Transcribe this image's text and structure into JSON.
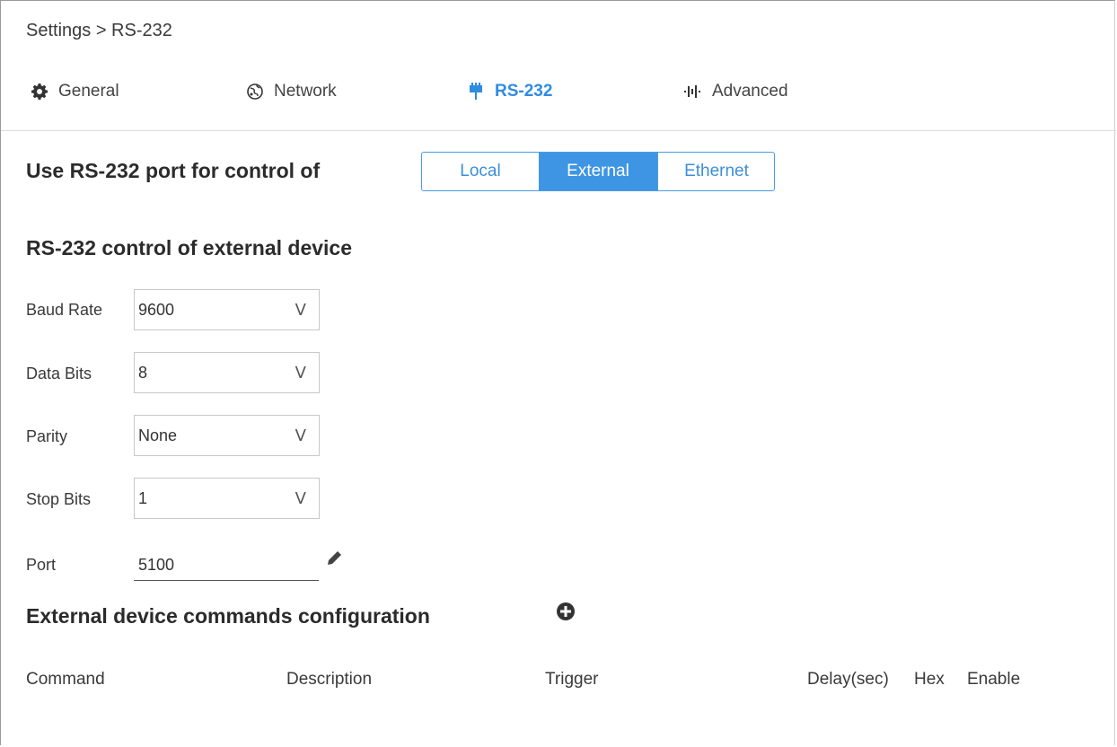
{
  "breadcrumb": "Settings > RS-232",
  "tabs": [
    {
      "label": "General",
      "icon": "gear-icon",
      "active": false
    },
    {
      "label": "Network",
      "icon": "network-globe-icon",
      "active": false
    },
    {
      "label": "RS-232",
      "icon": "serial-connector-icon",
      "active": true
    },
    {
      "label": "Advanced",
      "icon": "equalizer-icon",
      "active": false
    }
  ],
  "control": {
    "title": "Use RS-232 port for control of",
    "options": [
      "Local",
      "External",
      "Ethernet"
    ],
    "selected": "External"
  },
  "external": {
    "title": "RS-232 control of external device",
    "baud_rate": {
      "label": "Baud Rate",
      "value": "9600"
    },
    "data_bits": {
      "label": "Data Bits",
      "value": "8"
    },
    "parity": {
      "label": "Parity",
      "value": "None"
    },
    "stop_bits": {
      "label": "Stop Bits",
      "value": "1"
    },
    "port": {
      "label": "Port",
      "value": "5100"
    },
    "chevron": "V"
  },
  "commands": {
    "title": "External device commands configuration",
    "columns": [
      "Command",
      "Description",
      "Trigger",
      "Delay(sec)",
      "Hex",
      "Enable"
    ]
  },
  "colors": {
    "accent": "#3e95e3",
    "text": "#333333",
    "border": "#c8c8c8"
  }
}
